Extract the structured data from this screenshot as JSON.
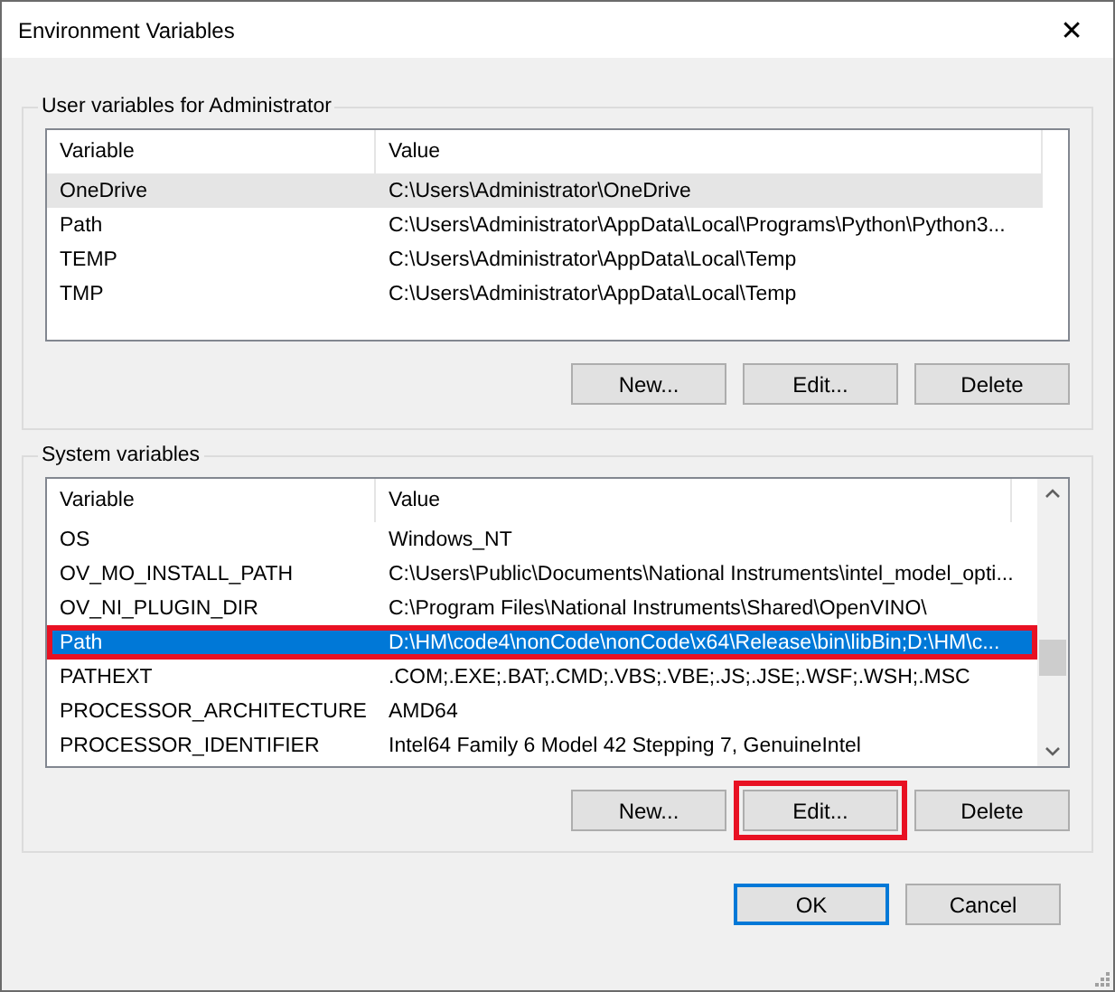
{
  "window": {
    "title": "Environment Variables",
    "close": "✕"
  },
  "user_variables": {
    "title": "User variables for Administrator",
    "columns": [
      "Variable",
      "Value"
    ],
    "rows": [
      {
        "variable": "OneDrive",
        "value": "C:\\Users\\Administrator\\OneDrive",
        "selected": false,
        "hovered": true,
        "annotated": false
      },
      {
        "variable": "Path",
        "value": "C:\\Users\\Administrator\\AppData\\Local\\Programs\\Python\\Python3...",
        "selected": false,
        "hovered": false,
        "annotated": false
      },
      {
        "variable": "TEMP",
        "value": "C:\\Users\\Administrator\\AppData\\Local\\Temp",
        "selected": false,
        "hovered": false,
        "annotated": false
      },
      {
        "variable": "TMP",
        "value": "C:\\Users\\Administrator\\AppData\\Local\\Temp",
        "selected": false,
        "hovered": false,
        "annotated": false
      }
    ],
    "buttons": [
      {
        "label": "New...",
        "annotated": false
      },
      {
        "label": "Edit...",
        "annotated": false
      },
      {
        "label": "Delete",
        "annotated": false
      }
    ]
  },
  "system_variables": {
    "title": "System variables",
    "columns": [
      "Variable",
      "Value"
    ],
    "rows": [
      {
        "variable": "OS",
        "value": "Windows_NT",
        "selected": false,
        "hovered": false,
        "annotated": false
      },
      {
        "variable": "OV_MO_INSTALL_PATH",
        "value": "C:\\Users\\Public\\Documents\\National Instruments\\intel_model_opti...",
        "selected": false,
        "hovered": false,
        "annotated": false
      },
      {
        "variable": "OV_NI_PLUGIN_DIR",
        "value": "C:\\Program Files\\National Instruments\\Shared\\OpenVINO\\",
        "selected": false,
        "hovered": false,
        "annotated": false
      },
      {
        "variable": "Path",
        "value": "D:\\HM\\code4\\nonCode\\nonCode\\x64\\Release\\bin\\libBin;D:\\HM\\c...",
        "selected": true,
        "hovered": false,
        "annotated": true
      },
      {
        "variable": "PATHEXT",
        "value": ".COM;.EXE;.BAT;.CMD;.VBS;.VBE;.JS;.JSE;.WSF;.WSH;.MSC",
        "selected": false,
        "hovered": false,
        "annotated": false
      },
      {
        "variable": "PROCESSOR_ARCHITECTURE",
        "value": "AMD64",
        "selected": false,
        "hovered": false,
        "annotated": false
      },
      {
        "variable": "PROCESSOR_IDENTIFIER",
        "value": "Intel64 Family 6 Model 42 Stepping 7, GenuineIntel",
        "selected": false,
        "hovered": false,
        "annotated": false
      }
    ],
    "buttons": [
      {
        "label": "New...",
        "annotated": false
      },
      {
        "label": "Edit...",
        "annotated": true
      },
      {
        "label": "Delete",
        "annotated": false
      }
    ]
  },
  "buttons": [
    {
      "label": "OK",
      "default": true
    },
    {
      "label": "Cancel",
      "default": false
    }
  ]
}
